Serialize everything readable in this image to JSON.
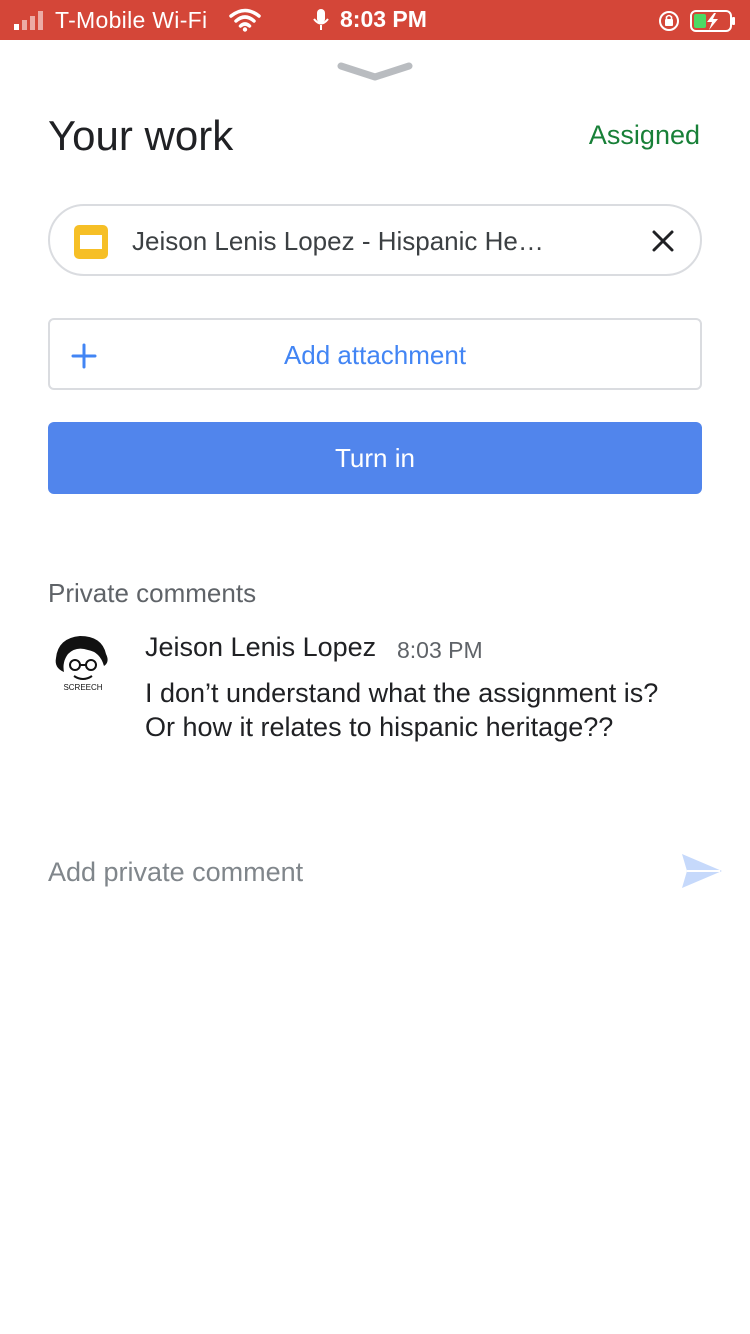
{
  "status_bar": {
    "carrier": "T-Mobile Wi-Fi",
    "time": "8:03 PM",
    "icons": [
      "signal-icon",
      "wifi-icon",
      "microphone-icon",
      "rotation-lock-icon",
      "battery-charging-icon"
    ]
  },
  "header": {
    "title": "Your work",
    "status": "Assigned"
  },
  "attachment": {
    "name": "Jeison Lenis Lopez - Hispanic Herita...",
    "icon": "slides-icon",
    "remove_icon": "close-icon"
  },
  "actions": {
    "add_attachment_label": "Add attachment",
    "turn_in_label": "Turn in"
  },
  "private_comments": {
    "section_title": "Private comments",
    "comments": [
      {
        "author": "Jeison Lenis Lopez",
        "time": "8:03 PM",
        "text": "I don’t understand what the assignment is? Or how it relates to hispanic heritage??",
        "avatar_caption": "SCREECH"
      }
    ],
    "input_placeholder": "Add private comment"
  },
  "colors": {
    "status_bar": "#d44638",
    "accent_blue": "#4285f4",
    "button_blue": "#5185ec",
    "assigned_green": "#188038",
    "slides_yellow": "#f6bf26"
  }
}
